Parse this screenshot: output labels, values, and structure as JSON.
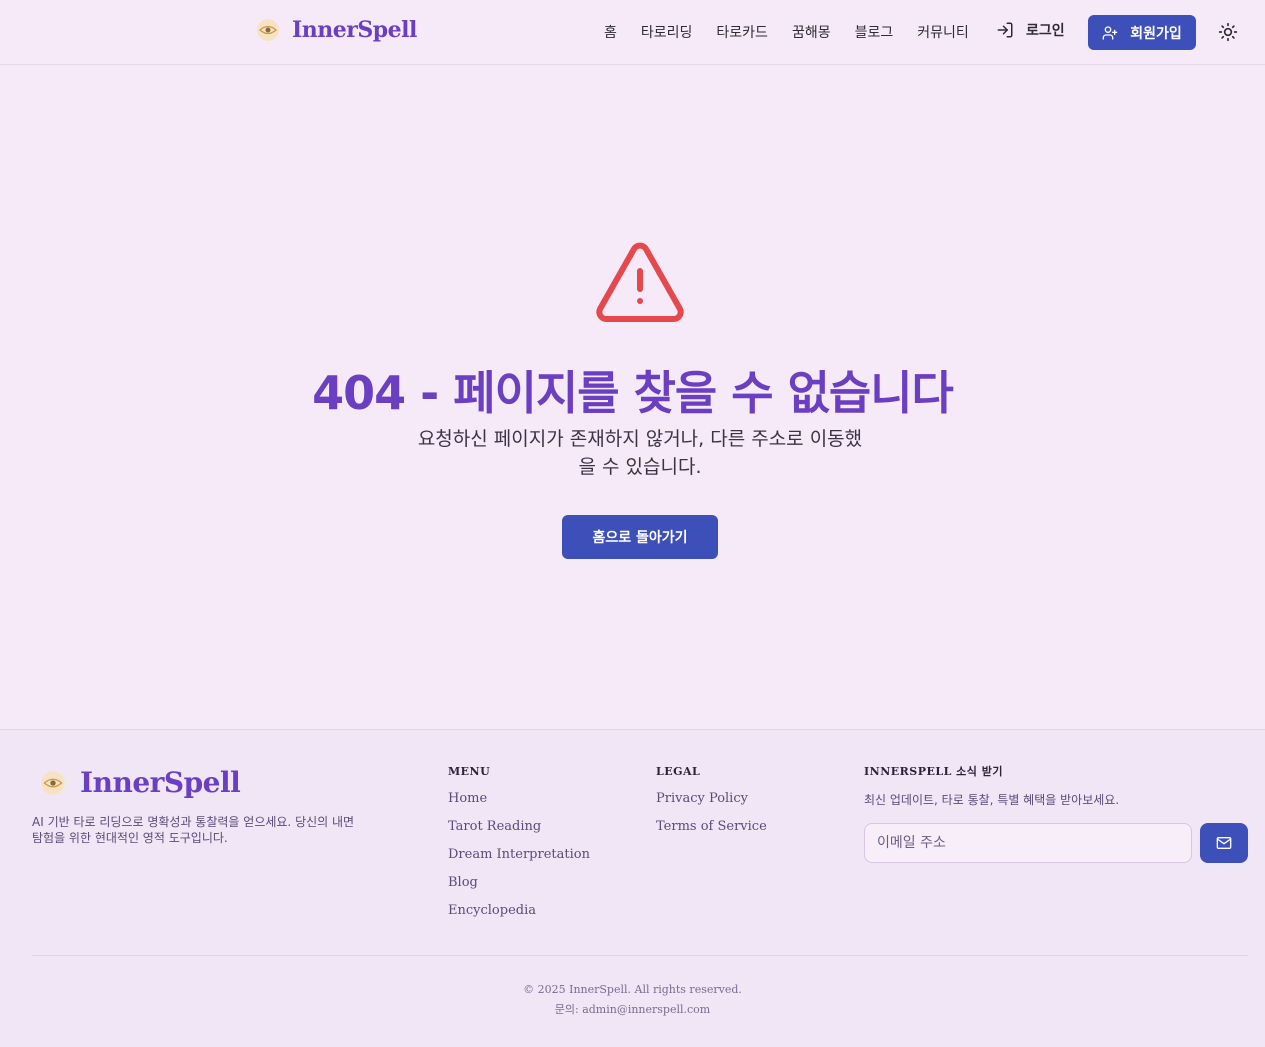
{
  "header": {
    "brand": "InnerSpell",
    "nav": [
      "홈",
      "타로리딩",
      "타로카드",
      "꿈해몽",
      "블로그",
      "커뮤니티"
    ],
    "login_label": "로그인",
    "signup_label": "회원가입",
    "theme_icon": "sun-icon"
  },
  "main": {
    "title": "404 - 페이지를 찾을 수 없습니다",
    "subtitle": "요청하신 페이지가 존재하지 않거나, 다른 주소로 이동했을 수 있습니다.",
    "home_button": "홈으로 돌아가기",
    "icon": "warning-icon",
    "icon_color": "#e5484d"
  },
  "footer": {
    "brand": "InnerSpell",
    "description": "AI 기반 타로 리딩으로 명확성과 통찰력을 얻으세요. 당신의 내면 탐험을 위한 현대적인 영적 도구입니다.",
    "menu_title": "MENU",
    "menu_links": [
      "Home",
      "Tarot Reading",
      "Dream Interpretation",
      "Blog",
      "Encyclopedia"
    ],
    "legal_title": "LEGAL",
    "legal_links": [
      "Privacy Policy",
      "Terms of Service"
    ],
    "newsletter_title": "INNERSPELL 소식 받기",
    "newsletter_desc": "최신 업데이트, 타로 통찰, 특별 혜택을 받아보세요.",
    "email_placeholder": "이메일 주소",
    "copyright": "© 2025 InnerSpell. All rights reserved.",
    "contact": "문의: admin@innerspell.com"
  },
  "colors": {
    "background": "#f6eaf8",
    "brand_purple": "#6b3fc2",
    "button_blue": "#3d4fb8",
    "warning_red": "#e5484d"
  }
}
